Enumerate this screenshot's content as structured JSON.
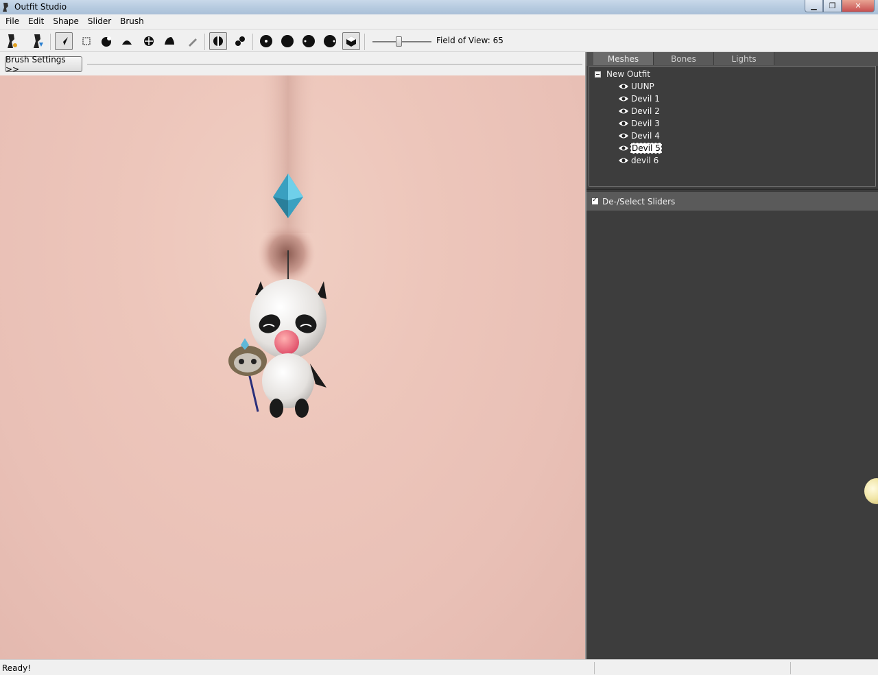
{
  "window": {
    "title": "Outfit Studio",
    "controls": [
      "minimize",
      "restore",
      "close"
    ]
  },
  "menu": [
    "File",
    "Edit",
    "Shape",
    "Slider",
    "Brush"
  ],
  "toolbar": {
    "tools": [
      "new-project-icon",
      "load-outfit-icon",
      "select-tool-icon",
      "transform-tool-icon",
      "inflate-brush-icon",
      "deflate-brush-icon",
      "move-brush-icon",
      "smooth-brush-icon",
      "weight-brush-icon",
      "x-mirror-icon",
      "connected-only-icon",
      "brush-size-small-icon",
      "brush-size-medium-icon",
      "brush-size-large-icon",
      "brush-size-xlarge-icon",
      "global-brush-icon"
    ],
    "fov_label": "Field of View: 65",
    "fov_value": 65
  },
  "brush_settings_button": "Brush Settings >>",
  "right_panel": {
    "tabs": [
      "Meshes",
      "Bones",
      "Lights"
    ],
    "active_tab": "Meshes",
    "tree": {
      "root": "New Outfit",
      "items": [
        {
          "label": "UUNP",
          "selected": false
        },
        {
          "label": "Devil 1",
          "selected": false
        },
        {
          "label": "Devil 2",
          "selected": false
        },
        {
          "label": "Devil 3",
          "selected": false
        },
        {
          "label": "Devil 4",
          "selected": false
        },
        {
          "label": "Devil 5",
          "selected": true
        },
        {
          "label": "devil 6",
          "selected": false
        }
      ]
    },
    "sliders_header": "De-/Select Sliders"
  },
  "status": {
    "text": "Ready!"
  },
  "colors": {
    "panel_bg": "#3d3d3d",
    "tab_bg": "#5a5a5a",
    "skin": "#ecc5ba",
    "gem": "#3aa0c0"
  }
}
